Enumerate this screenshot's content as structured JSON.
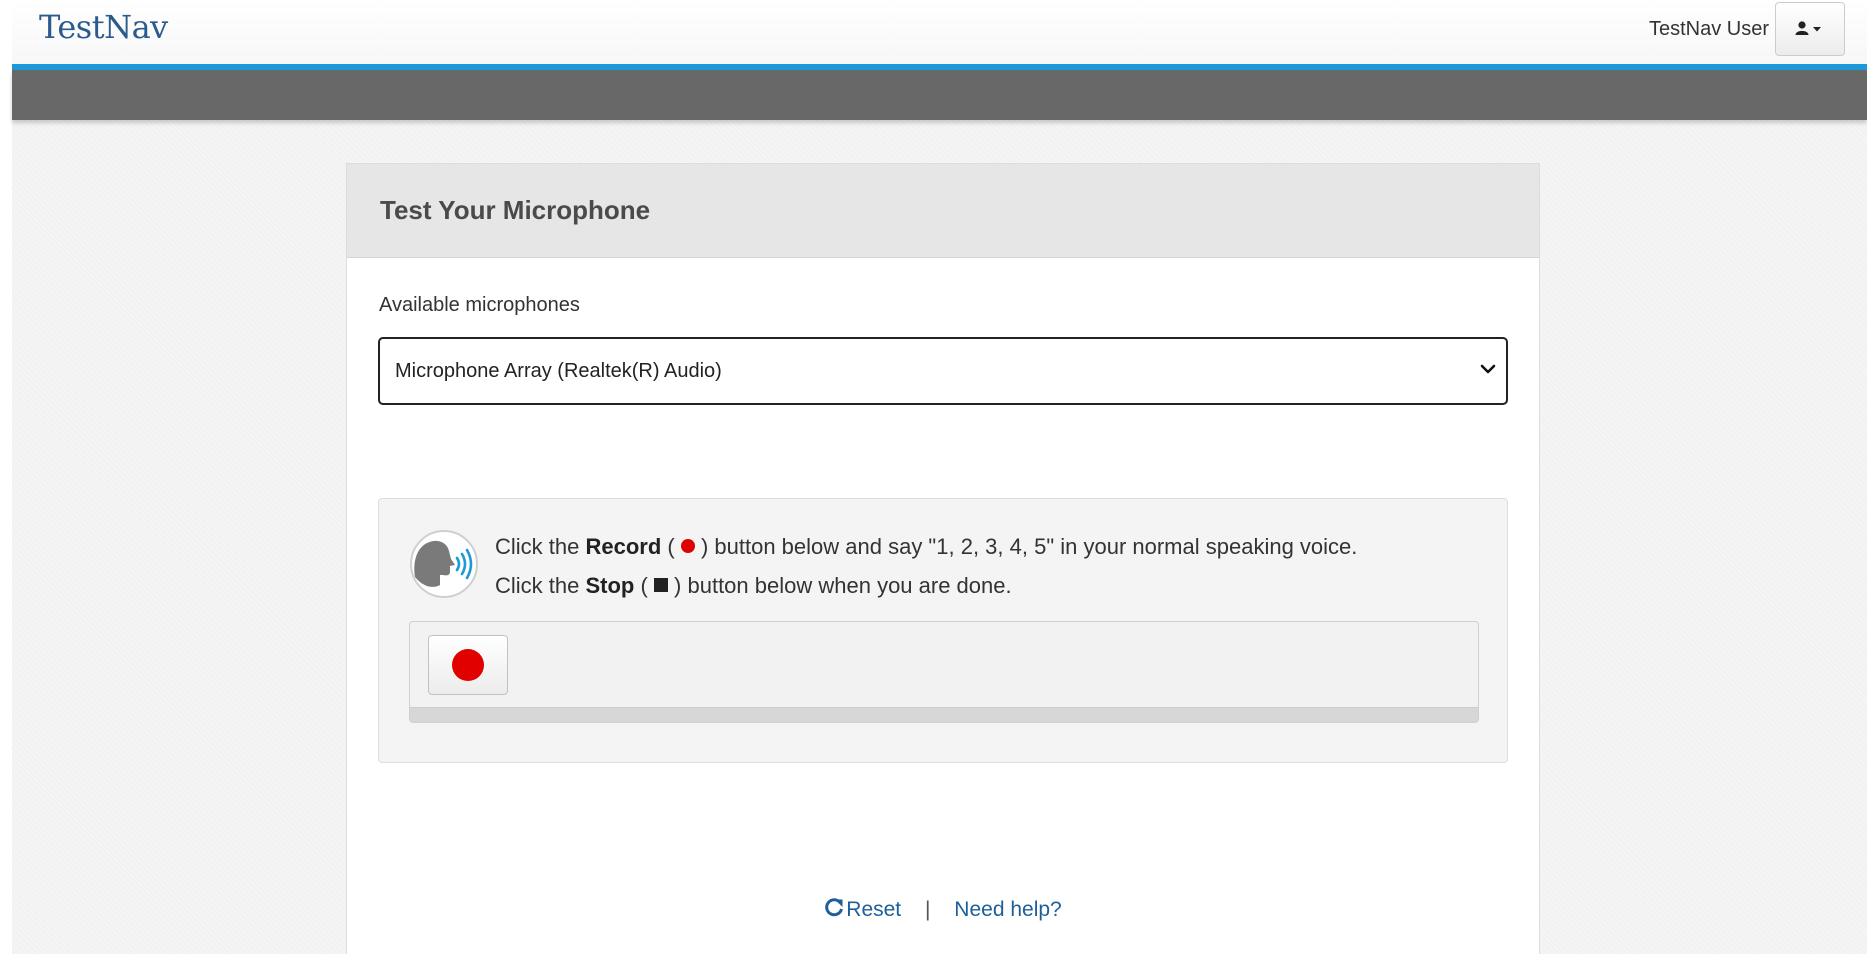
{
  "header": {
    "logo": "TestNav",
    "user_name": "TestNav User",
    "user_icon": "user-icon",
    "accent_color": "#1b99d8"
  },
  "card": {
    "title": "Test Your Microphone",
    "mic_label": "Available microphones",
    "mic_selected": "Microphone Array (Realtek(R) Audio)",
    "instructions": {
      "line1_prefix": "Click the ",
      "record_word": "Record",
      "line1_open": " ( ",
      "line1_suffix": " ) button below and say \"1, 2, 3, 4, 5\" in your normal speaking voice.",
      "line2_prefix": "Click the ",
      "stop_word": "Stop",
      "line2_open": " ( ",
      "line2_suffix": " ) button below when you are done."
    },
    "record_color": "#e00000"
  },
  "footer": {
    "reset_label": "Reset",
    "separator": "|",
    "help_label": "Need help?"
  }
}
